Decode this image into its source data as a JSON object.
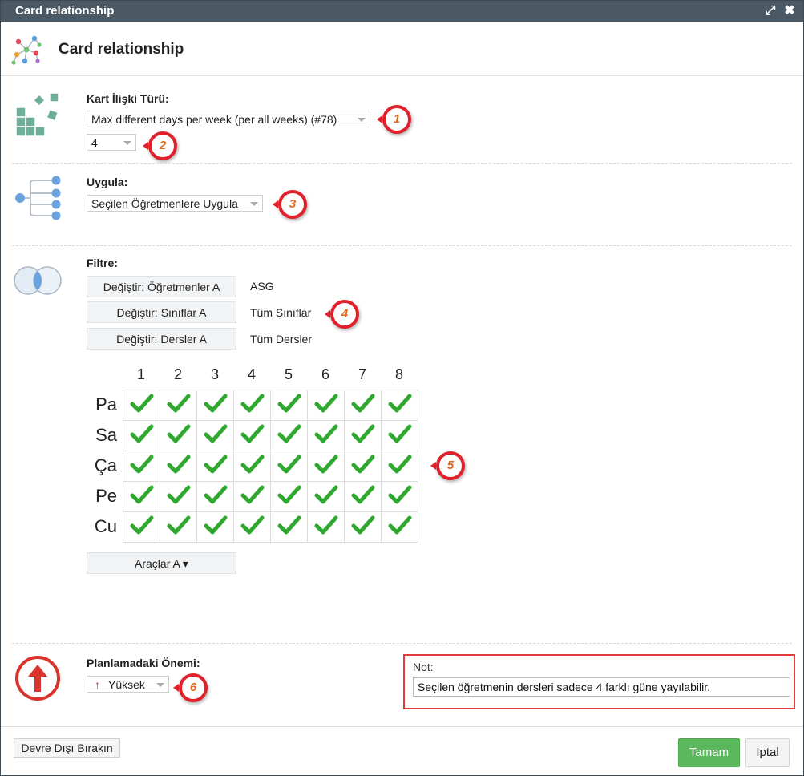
{
  "window": {
    "title": "Card relationship",
    "dialog_title": "Card relationship",
    "maximize_glyph": "⤢",
    "close_glyph": "✖"
  },
  "relation": {
    "label": "Kart İlişki Türü:",
    "type_value": "Max different days per week (per all weeks) (#78)",
    "count_value": "4"
  },
  "apply": {
    "label": "Uygula:",
    "value": "Seçilen Öğretmenlere Uygula"
  },
  "filter": {
    "label": "Filtre:",
    "rows": [
      {
        "button": "Değiştir: Öğretmenler A",
        "value": "ASG"
      },
      {
        "button": "Değiştir: Sınıflar A",
        "value": "Tüm Sınıflar"
      },
      {
        "button": "Değiştir: Dersler A",
        "value": "Tüm Dersler"
      }
    ]
  },
  "grid": {
    "columns": [
      "1",
      "2",
      "3",
      "4",
      "5",
      "6",
      "7",
      "8"
    ],
    "rows": [
      "Pa",
      "Sa",
      "Ça",
      "Pe",
      "Cu"
    ],
    "all_checked": true,
    "check_color": "#2fa82f"
  },
  "tools": {
    "label": "Araçlar A ▾"
  },
  "importance": {
    "label": "Planlamadaki Önemi:",
    "value": "Yüksek",
    "arrow_glyph": "🠕"
  },
  "note": {
    "label": "Not:",
    "value": "Seçilen öğretmenin dersleri sadece 4 farklı güne yayılabilir."
  },
  "footer": {
    "disable_label": "Devre Dışı Bırakın",
    "ok_label": "Tamam",
    "cancel_label": "İptal"
  },
  "markers": [
    "1",
    "2",
    "3",
    "4",
    "5",
    "6"
  ],
  "colors": {
    "titlebar": "#4b5964",
    "marker": "#e0202b",
    "ok_button": "#5cb85c",
    "check": "#2fa82f",
    "importance_icon": "#d9342b"
  }
}
